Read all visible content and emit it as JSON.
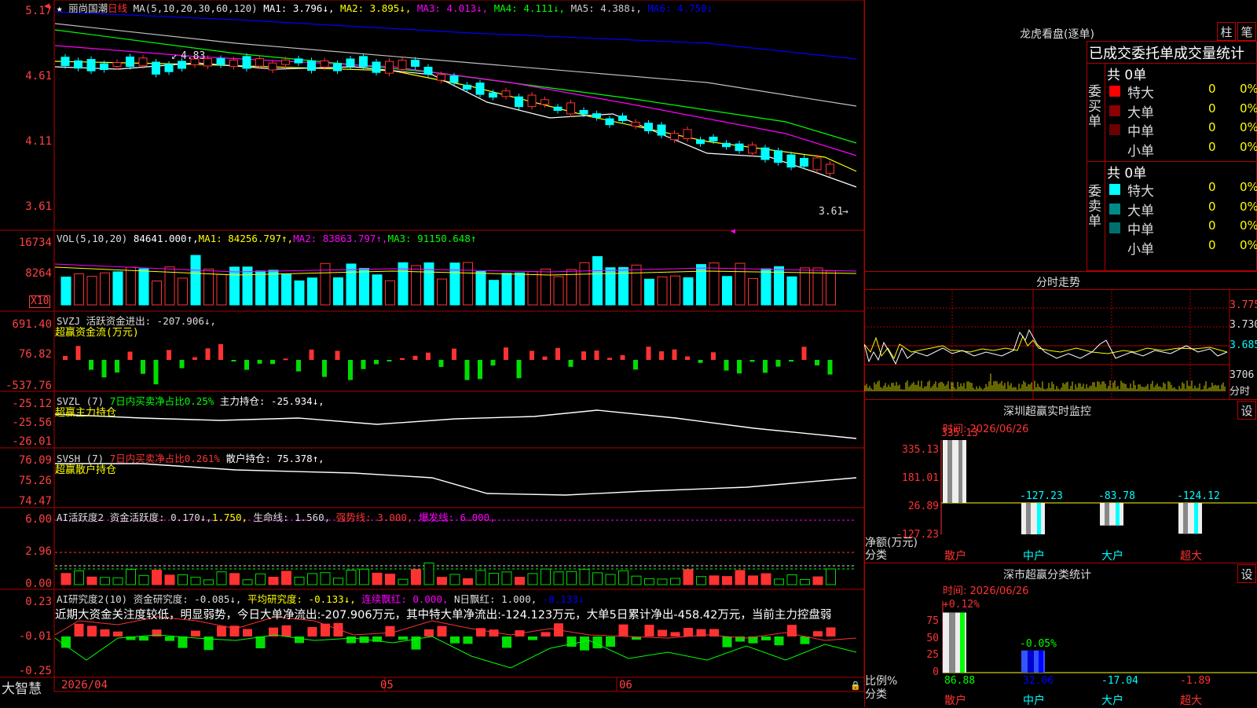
{
  "stock": {
    "name": "丽尚国潮",
    "period": "日线",
    "star": "★"
  },
  "ma_line": {
    "prefix": "MA(5,10,20,30,60,120)",
    "ma1": "MA1: 3.796↓,",
    "ma2": "MA2: 3.895↓,",
    "ma3": "MA3: 4.013↓,",
    "ma4": "MA4: 4.111↓,",
    "ma5": "MA5: 4.388↓,",
    "ma6": "MA6: 4.750↓"
  },
  "price_axis": [
    "5.17",
    "4.61",
    "4.11",
    "3.61"
  ],
  "price_annot": {
    "high": "4.83",
    "low": "3.61"
  },
  "vol_header": {
    "prefix": "VOL(5,10,20)",
    "val": "84641.000↑,",
    "ma1": "MA1: 84256.797↑,",
    "ma2": "MA2: 83863.797↑,",
    "ma3": "MA3: 91150.648↑"
  },
  "vol_axis": [
    "16734",
    "8264"
  ],
  "vol_unit": "X10",
  "svzj": {
    "header": "SVZJ  活跃资金进出: -207.906↓,",
    "sub": "超赢资金流(万元)",
    "axis": [
      "691.40",
      "76.82",
      "-537.76"
    ]
  },
  "svzl": {
    "header_a": "SVZL (7) ",
    "header_b": "7日内买卖净占比0.25%",
    "header_c": " 主力持仓: -25.934↓,",
    "sub": "超赢主力持仓",
    "axis": [
      "-25.12",
      "-25.56",
      "-26.01"
    ]
  },
  "svsh": {
    "header_a": "SVSH (7) ",
    "header_b": "7日内买卖净占比0.261%",
    "header_c": " 散户持仓: 75.378↑,",
    "sub": "超赢散户持仓",
    "axis": [
      "76.09",
      "75.26",
      "74.47"
    ]
  },
  "ai1": {
    "a": "AI活跃度2 资金活跃度: 0.170↓,",
    "b": "1.750,",
    "c": " 生命线: 1.560,",
    "d": " 强势线: 3.000,",
    "e": " 爆发线: 6.000,",
    "axis": [
      "6.00",
      "2.96",
      "0.00"
    ]
  },
  "ai2": {
    "a": "AI研究度2(10) 资金研究度: -0.085↓,",
    "b": " 平均研究度: -0.133↓,",
    "c": " 连续飘红: 0.000,",
    "d": " N日飘红: 1.000,",
    "e": " -0.133↓",
    "axis": [
      "0.23",
      "-0.01",
      "-0.25"
    ],
    "note": "近期大资金关注度较低，明显弱势，今日大单净流出:-207.906万元，其中特大单净流出:-124.123万元，大单5日累计净出-458.42万元，当前主力控盘弱"
  },
  "time_axis": [
    "2026/04",
    "05",
    "06"
  ],
  "brand": "大智慧",
  "lhb": {
    "title": "龙虎看盘(逐单)",
    "btn1": "柱",
    "btn2": "笔",
    "subtitle": "已成交委托单成交量统计",
    "buy_label": "委买单",
    "sell_label": "委卖单",
    "buy_total": "共 0单",
    "sell_total": "共 0单",
    "buy_rows": [
      {
        "name": "特大",
        "n": "0",
        "p": "0%",
        "color": "#ff0000"
      },
      {
        "name": "大单",
        "n": "0",
        "p": "0%",
        "color": "#8b0000"
      },
      {
        "name": "中单",
        "n": "0",
        "p": "0%",
        "color": "#6a0000"
      },
      {
        "name": "小单",
        "n": "0",
        "p": "0%",
        "color": "#000000"
      }
    ],
    "sell_rows": [
      {
        "name": "特大",
        "n": "0",
        "p": "0%",
        "color": "#00ffff"
      },
      {
        "name": "大单",
        "n": "0",
        "p": "0%",
        "color": "#008b8b"
      },
      {
        "name": "中单",
        "n": "0",
        "p": "0%",
        "color": "#006f6f"
      },
      {
        "name": "小单",
        "n": "0",
        "p": "0%",
        "color": "#000000"
      }
    ]
  },
  "intraday": {
    "title": "分时走势",
    "axis": [
      "3.775",
      "3.730",
      "3.685",
      "3706",
      "分时"
    ]
  },
  "sz_monitor": {
    "title": "深圳超赢实时监控",
    "btn": "设",
    "time": "时间: 2026/06/26",
    "axis": [
      "335.13",
      "181.01",
      "26.89",
      "-127.23"
    ],
    "ylabel": "净额(万元)",
    "xlabel": "分类",
    "cats": [
      "散户",
      "中户",
      "大户",
      "超大"
    ],
    "values": [
      335.13,
      -127.23,
      -83.78,
      -124.12
    ],
    "labels": [
      "335.13",
      "-127.23",
      "-83.78",
      "-124.12"
    ]
  },
  "sz_stat": {
    "title": "深市超赢分类统计",
    "btn": "设",
    "time": "时间: 2026/06/26",
    "axis": [
      "75",
      "50",
      "25",
      "0"
    ],
    "ylabel": "比例%",
    "xlabel": "分类",
    "cats": [
      "散户",
      "中户",
      "大户",
      "超大"
    ],
    "top_labels": [
      "+0.12%",
      "-0.05%"
    ],
    "values": [
      "86.88",
      "32.06",
      "-17.04",
      "-1.89"
    ]
  },
  "colors": {
    "up": "#ff3232",
    "down": "#00ffff",
    "grid": "#b00000",
    "axis": "#ff4040",
    "ma1": "#ffffff",
    "ma2": "#ffff00",
    "ma3": "#ff00ff",
    "ma4": "#00ff00",
    "ma5": "#c0c0c0",
    "ma6": "#0000ff"
  }
}
